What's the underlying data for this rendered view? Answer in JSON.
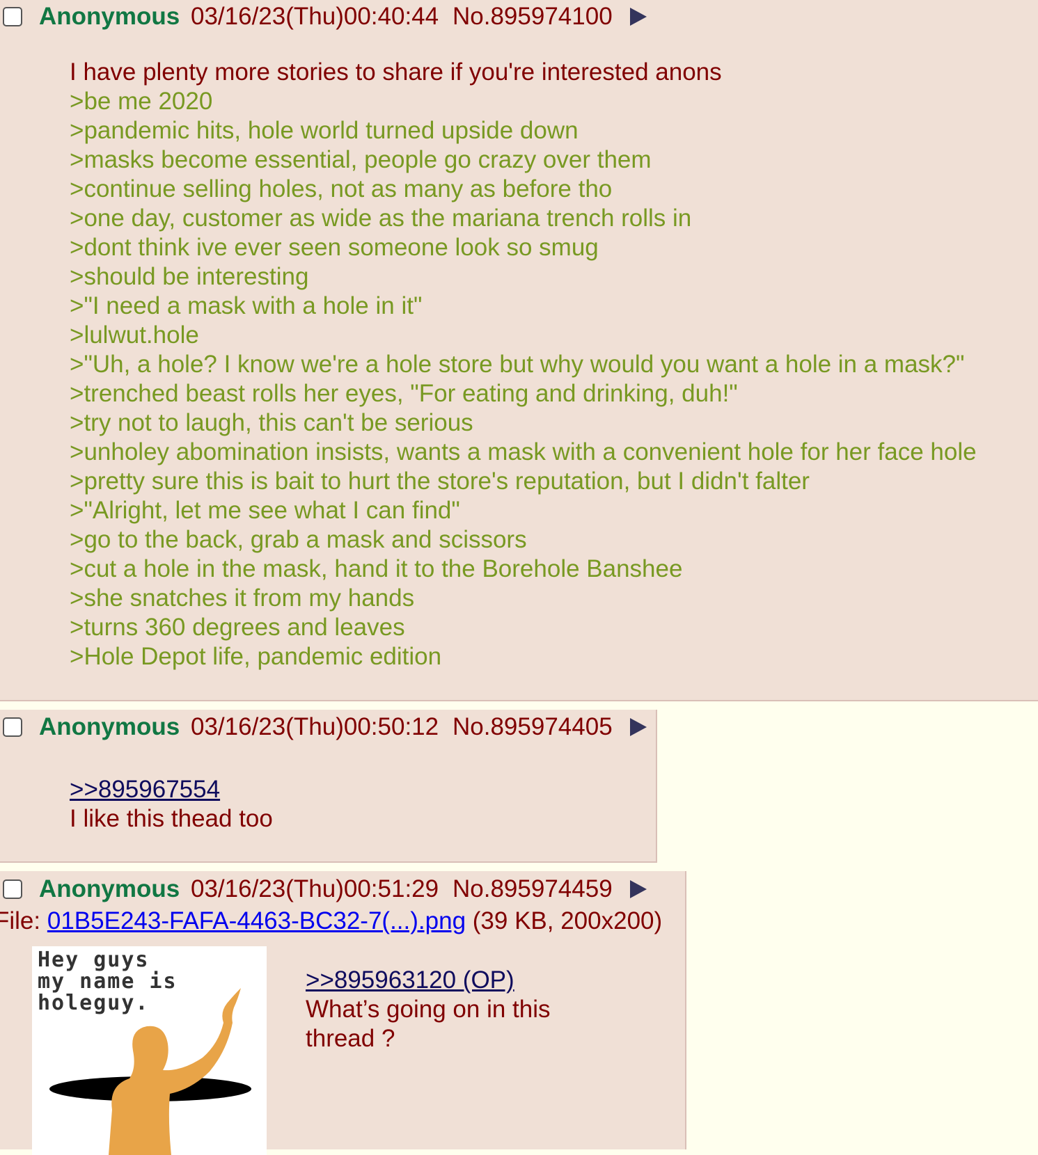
{
  "posts": [
    {
      "name": "Anonymous",
      "datetime": "03/16/23(Thu)00:40:44",
      "number": "No.895974100",
      "message": {
        "text": "I have plenty more stories to share if you're interested anons",
        "greentext": [
          ">be me 2020",
          ">pandemic hits, hole world turned upside down",
          ">masks become essential, people go crazy over them",
          ">continue selling holes, not as many as before tho",
          ">one day, customer as wide as the mariana trench rolls in",
          ">dont think ive ever seen someone look so smug",
          ">should be interesting",
          ">\"I need a mask with a hole in it\"",
          ">lulwut.hole",
          ">\"Uh, a hole? I know we're a hole store but why would you want a hole in a mask?\"",
          ">trenched beast rolls her eyes, \"For eating and drinking, duh!\"",
          ">try not to laugh, this can't be serious",
          ">unholey abomination insists, wants a mask with a convenient hole for her face hole",
          ">pretty sure this is bait to hurt the store's reputation, but I didn't falter",
          ">\"Alright, let me see what I can find\"",
          ">go to the back, grab a mask and scissors",
          ">cut a hole in the mask, hand it to the Borehole Banshee",
          ">she snatches it from my hands",
          ">turns 360 degrees and leaves",
          ">Hole Depot life, pandemic edition"
        ]
      }
    },
    {
      "name": "Anonymous",
      "datetime": "03/16/23(Thu)00:50:12",
      "number": "No.895974405",
      "quotelink": ">>895967554",
      "text": "I like this thead too"
    },
    {
      "name": "Anonymous",
      "datetime": "03/16/23(Thu)00:51:29",
      "number": "No.895974459",
      "file": {
        "label": "File: ",
        "filename": "01B5E243-FAFA-4463-BC32-7(...).png",
        "meta": " (39 KB, 200x200)",
        "thumb_text": "Hey guys\nmy name is\nholeguy."
      },
      "quotelink": ">>895963120 (OP)",
      "text_lines": [
        "What’s going on in this",
        "thread ?"
      ]
    }
  ],
  "colors": {
    "background": "#FFFFEE",
    "post_bg": "#F0E0D6",
    "name": "#117743",
    "text": "#800000",
    "greentext": "#789922",
    "link": "#0F0C5D",
    "file_link": "#0000EE",
    "menu_arrow": "#34345C",
    "figure": "#E8A448",
    "hole": "#000000"
  },
  "icons": [
    "checkbox-icon",
    "post-menu-arrow-icon"
  ]
}
